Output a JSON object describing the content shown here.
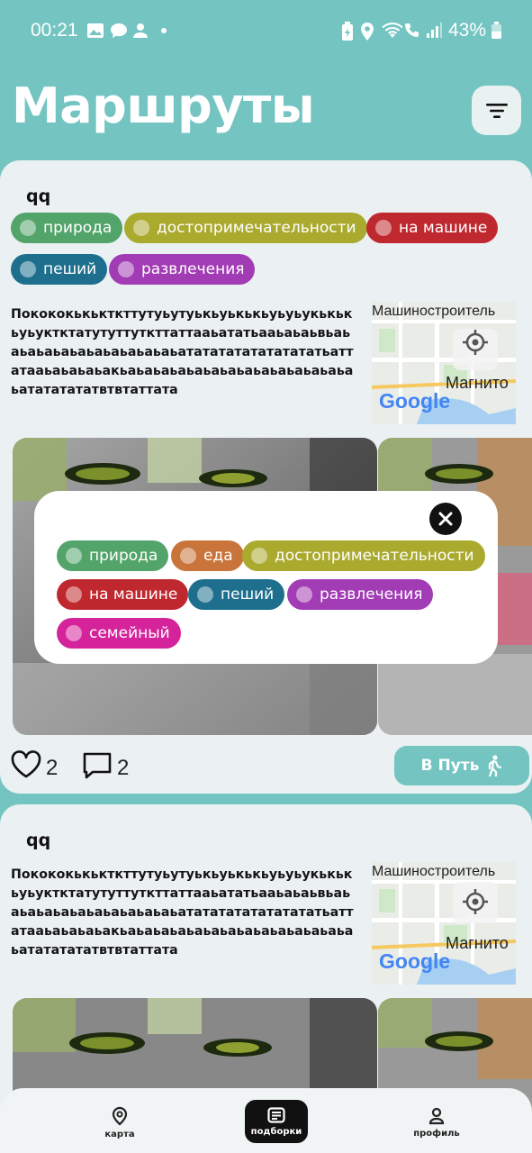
{
  "status_bar": {
    "time": "00:21",
    "battery": "43%"
  },
  "header": {
    "title": "Маршруты"
  },
  "colors": {
    "priroda": "#53a46b",
    "eda": "#c9743a",
    "dostoprim": "#aaaa2f",
    "mashina": "#c0282f",
    "peshiy": "#1e6f8e",
    "razvlech": "#a23cb5",
    "semeyniy": "#d5239b"
  },
  "card1": {
    "author": "qq",
    "tags": [
      "природа",
      "достопримечательности",
      "на машине",
      "пеший",
      "развлечения"
    ],
    "description": "Покококькькткттутуьутуькьуькькьуьуьукькькьуьуктктатутуттуткттаттааьататьааьаьаьвьаьаьаьаьаьаьаьаьаьаьаьатататататататататьаттатааьаьаьаьакьаьаьаьаьаьаьаьаьаьаьаьаьаьаьатататататвтвтаттата",
    "map": {
      "label_top": "Машиностроитель",
      "label_right": "Магнито",
      "logo": "Google"
    },
    "likes": "2",
    "comments": "2",
    "go_label": "В Путь"
  },
  "card2": {
    "author": "qq",
    "description": "Покококькькткттутуьутуькьуькькьуьуьукькькьуьуктктатутуттуткттаттааьататьааьаьаьвьаьаьаьаьаьаьаьаьаьаьаьатататататататататьаттатааьаьаьаьакьаьаьаьаьаьаьаьаьаьаьаьаьаьаьатататататвтвтаттата",
    "map": {
      "label_top": "Машиностроитель",
      "label_right": "Магнито",
      "logo": "Google"
    }
  },
  "popup": {
    "tags": [
      "природа",
      "еда",
      "достопримечательности",
      "на машине",
      "пеший",
      "развлечения",
      "семейный"
    ]
  },
  "bottom_nav": {
    "map": "карта",
    "collections": "подборки",
    "profile": "профиль"
  }
}
